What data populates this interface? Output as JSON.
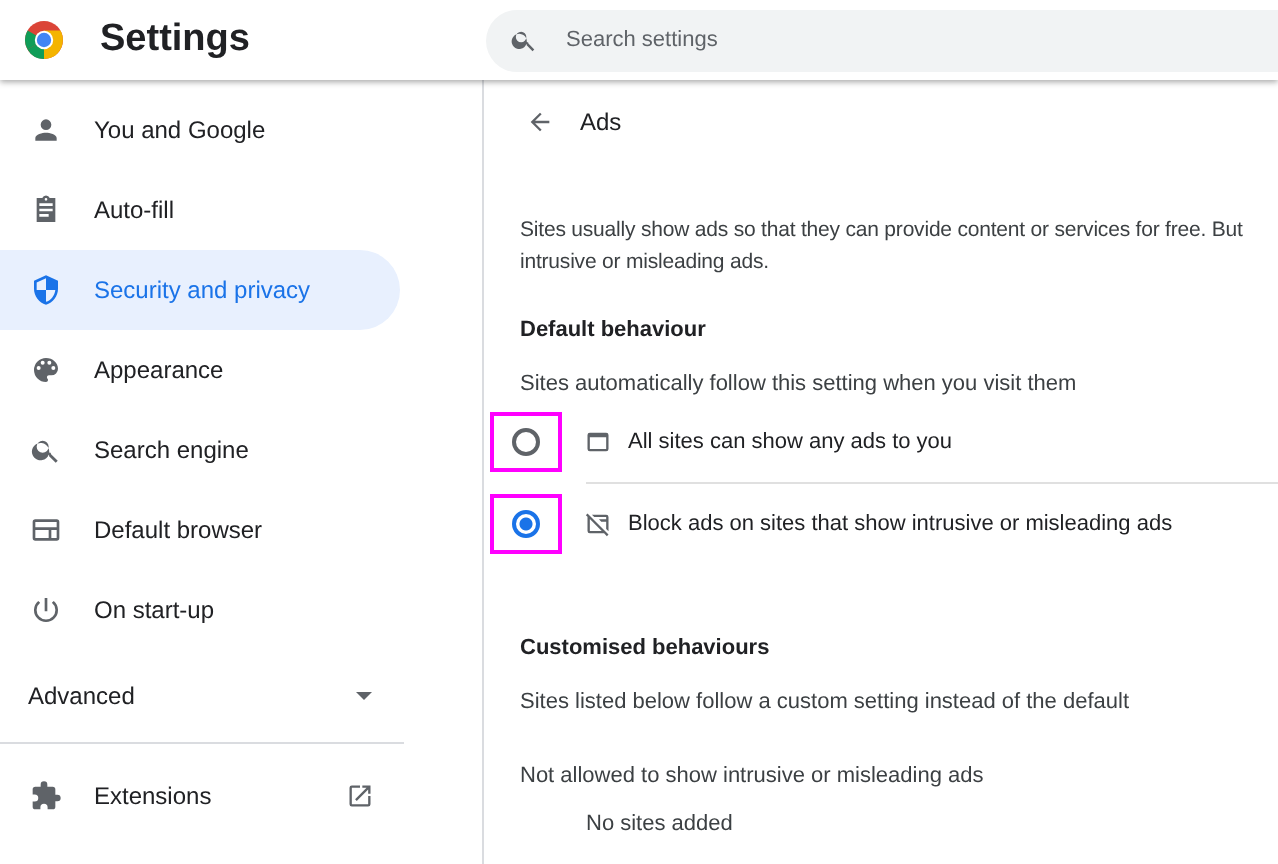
{
  "header": {
    "title": "Settings",
    "search": {
      "placeholder": "Search settings"
    }
  },
  "sidebar": {
    "items": [
      {
        "label": "You and Google",
        "kind": "person",
        "selected": false
      },
      {
        "label": "Auto-fill",
        "kind": "clipboard",
        "selected": false
      },
      {
        "label": "Security and privacy",
        "kind": "shield",
        "selected": true
      },
      {
        "label": "Appearance",
        "kind": "palette",
        "selected": false
      },
      {
        "label": "Search engine",
        "kind": "search",
        "selected": false
      },
      {
        "label": "Default browser",
        "kind": "browser",
        "selected": false
      },
      {
        "label": "On start-up",
        "kind": "power",
        "selected": false
      }
    ],
    "advanced": {
      "label": "Advanced",
      "expanded": false
    },
    "extensions": {
      "label": "Extensions"
    }
  },
  "page": {
    "title": "Ads",
    "description": [
      "Sites usually show ads so that they can provide content or services for free. But",
      "intrusive or misleading ads."
    ],
    "default_section": {
      "heading": "Default behaviour",
      "subtitle": "Sites automatically follow this setting when you visit them",
      "options": [
        {
          "label": "All sites can show any ads to you",
          "kind": "window",
          "selected": false,
          "highlighted": true
        },
        {
          "label": "Block ads on sites that show intrusive or misleading ads",
          "kind": "blocked",
          "selected": true,
          "highlighted": true
        }
      ]
    },
    "custom_section": {
      "heading": "Customised behaviours",
      "subtitle": "Sites listed below follow a custom setting instead of the default",
      "list_title": "Not allowed to show intrusive or misleading ads",
      "empty_text": "No sites added"
    }
  }
}
